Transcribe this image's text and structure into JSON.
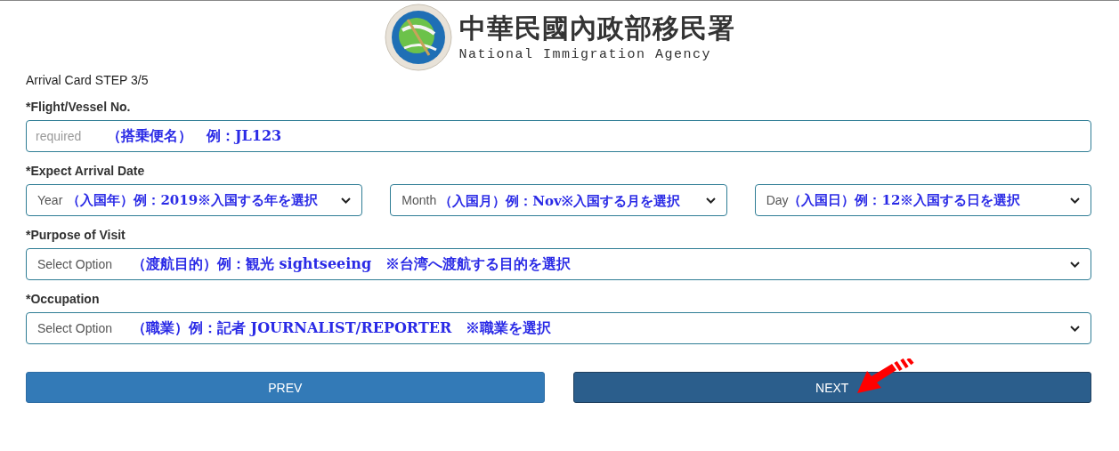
{
  "logo": {
    "title": "中華民國內政部移民署",
    "subtitle": "National Immigration Agency"
  },
  "step": "Arrival Card STEP 3/5",
  "fields": [
    {
      "kind": "input",
      "label": "*Flight/Vessel No.",
      "placeholder": "required",
      "note": "（搭乗便名）　例：JL123"
    },
    {
      "kind": "date",
      "label": "*Expect Arrival Date",
      "selects": [
        {
          "value": "Year",
          "note": "（入国年）例：2019※入国する年を選択"
        },
        {
          "value": "Month",
          "note": "（入国月）例：Nov※入国する月を選択"
        },
        {
          "value": "Day",
          "note": "（入国日）例：12※入国する日を選択"
        }
      ]
    },
    {
      "kind": "select",
      "label": "*Purpose of Visit",
      "value": "Select Option",
      "note": "（渡航目的）例：観光 sightseeing　※台湾へ渡航する目的を選択"
    },
    {
      "kind": "select",
      "label": "*Occupation",
      "value": "Select Option",
      "note": "（職業）例：記者 JOURNALIST/REPORTER　※職業を選択"
    }
  ],
  "buttons": [
    {
      "label": "PREV",
      "focused": false
    },
    {
      "label": "NEXT",
      "focused": true
    }
  ]
}
